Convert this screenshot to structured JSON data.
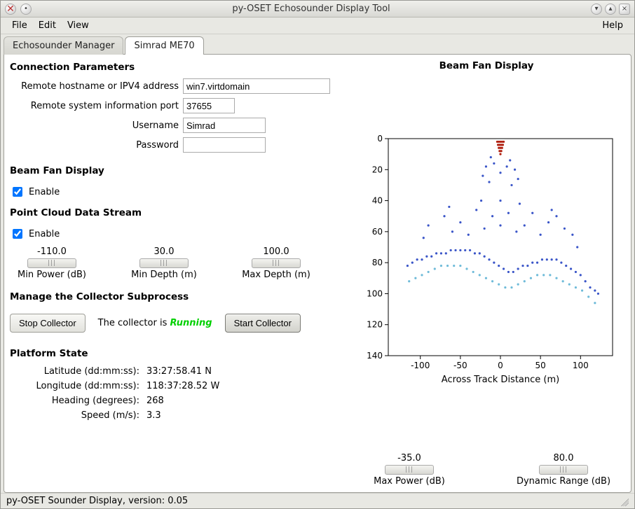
{
  "window": {
    "title": "py-OSET Echosounder Display Tool",
    "icons": {
      "app": "app-x-icon",
      "minimize": "minimize-icon",
      "maximize": "maximize-icon",
      "close": "close-icon",
      "unknown": "dot-icon"
    }
  },
  "menu": {
    "file": "File",
    "edit": "Edit",
    "view": "View",
    "help": "Help"
  },
  "tabs": [
    {
      "label": "Echosounder Manager",
      "active": false
    },
    {
      "label": "Simrad ME70",
      "active": true
    }
  ],
  "connection": {
    "heading": "Connection Parameters",
    "hostname_label": "Remote hostname or IPV4 address",
    "port_label": "Remote system information port",
    "username_label": "Username",
    "password_label": "Password",
    "hostname": "win7.virtdomain",
    "port": "37655",
    "username": "Simrad",
    "password": ""
  },
  "beamfan_section": {
    "heading": "Beam Fan Display",
    "enable_label": "Enable",
    "enable_checked": true
  },
  "pointcloud": {
    "heading": "Point Cloud Data Stream",
    "enable_label": "Enable",
    "enable_checked": true,
    "sliders": [
      {
        "value": "-110.0",
        "label": "Min Power (dB)"
      },
      {
        "value": "30.0",
        "label": "Min Depth (m)"
      },
      {
        "value": "100.0",
        "label": "Max Depth (m)"
      }
    ]
  },
  "collector": {
    "heading": "Manage the Collector Subprocess",
    "stop_label": "Stop Collector",
    "start_label": "Start Collector",
    "status_prefix": "The collector is ",
    "status_value": "Running"
  },
  "platform": {
    "heading": "Platform State",
    "rows": [
      {
        "label": "Latitude (dd:mm:ss):",
        "value": "33:27:58.41 N"
      },
      {
        "label": "Longitude (dd:mm:ss):",
        "value": "118:37:28.52 W"
      },
      {
        "label": "Heading (degrees):",
        "value": "268"
      },
      {
        "label": "Speed (m/s):",
        "value": "3.3"
      }
    ]
  },
  "beamfan_panel": {
    "title": "Beam Fan Display",
    "bottom_sliders": [
      {
        "value": "-35.0",
        "label": "Max Power (dB)"
      },
      {
        "value": "80.0",
        "label": "Dynamic Range (dB)"
      }
    ]
  },
  "chart_data": {
    "type": "scatter",
    "xlabel": "Across Track Distance (m)",
    "ylabel": "",
    "xlim": [
      -140,
      140
    ],
    "ylim": [
      140,
      0
    ],
    "xticks": [
      -100,
      -50,
      0,
      50,
      100
    ],
    "yticks": [
      0,
      20,
      40,
      60,
      80,
      100,
      120,
      140
    ],
    "series": [
      {
        "name": "dense-top",
        "color": "#b02010",
        "points": [
          [
            -4,
            2
          ],
          [
            -2,
            2
          ],
          [
            0,
            2
          ],
          [
            2,
            2
          ],
          [
            4,
            2
          ],
          [
            -3,
            4
          ],
          [
            -1,
            4
          ],
          [
            1,
            4
          ],
          [
            3,
            4
          ],
          [
            -2,
            6
          ],
          [
            0,
            6
          ],
          [
            2,
            6
          ],
          [
            -1,
            8
          ],
          [
            1,
            8
          ],
          [
            0,
            10
          ]
        ]
      },
      {
        "name": "sparse-top",
        "color": "#3a55c8",
        "points": [
          [
            -12,
            12
          ],
          [
            12,
            14
          ],
          [
            -18,
            18
          ],
          [
            18,
            20
          ],
          [
            -22,
            24
          ],
          [
            22,
            26
          ],
          [
            -8,
            16
          ],
          [
            8,
            18
          ],
          [
            0,
            22
          ],
          [
            -14,
            28
          ],
          [
            14,
            30
          ]
        ]
      },
      {
        "name": "band",
        "color": "#3a55c8",
        "points": [
          [
            -116,
            82
          ],
          [
            -110,
            80
          ],
          [
            -104,
            78
          ],
          [
            -98,
            78
          ],
          [
            -92,
            76
          ],
          [
            -86,
            76
          ],
          [
            -80,
            74
          ],
          [
            -74,
            74
          ],
          [
            -68,
            74
          ],
          [
            -62,
            72
          ],
          [
            -56,
            72
          ],
          [
            -50,
            72
          ],
          [
            -44,
            72
          ],
          [
            -38,
            72
          ],
          [
            -32,
            74
          ],
          [
            -26,
            74
          ],
          [
            -20,
            76
          ],
          [
            -14,
            78
          ],
          [
            -8,
            80
          ],
          [
            -2,
            82
          ],
          [
            4,
            84
          ],
          [
            10,
            86
          ],
          [
            16,
            86
          ],
          [
            22,
            84
          ],
          [
            28,
            82
          ],
          [
            34,
            82
          ],
          [
            40,
            80
          ],
          [
            46,
            80
          ],
          [
            52,
            78
          ],
          [
            58,
            78
          ],
          [
            64,
            78
          ],
          [
            70,
            78
          ],
          [
            76,
            80
          ],
          [
            82,
            82
          ],
          [
            88,
            84
          ],
          [
            94,
            86
          ],
          [
            100,
            88
          ],
          [
            106,
            92
          ],
          [
            112,
            96
          ],
          [
            118,
            98
          ],
          [
            122,
            100
          ]
        ]
      },
      {
        "name": "band-lower",
        "color": "#6fbbd9",
        "points": [
          [
            -114,
            92
          ],
          [
            -106,
            90
          ],
          [
            -98,
            88
          ],
          [
            -90,
            86
          ],
          [
            -82,
            84
          ],
          [
            -74,
            82
          ],
          [
            -66,
            82
          ],
          [
            -58,
            82
          ],
          [
            -50,
            82
          ],
          [
            -42,
            84
          ],
          [
            -34,
            86
          ],
          [
            -26,
            88
          ],
          [
            -18,
            90
          ],
          [
            -10,
            92
          ],
          [
            -2,
            94
          ],
          [
            6,
            96
          ],
          [
            14,
            96
          ],
          [
            22,
            94
          ],
          [
            30,
            92
          ],
          [
            38,
            90
          ],
          [
            46,
            88
          ],
          [
            54,
            88
          ],
          [
            62,
            88
          ],
          [
            70,
            90
          ],
          [
            78,
            92
          ],
          [
            86,
            94
          ],
          [
            94,
            96
          ],
          [
            102,
            98
          ],
          [
            110,
            102
          ],
          [
            118,
            106
          ]
        ]
      },
      {
        "name": "noise",
        "color": "#3a55c8",
        "points": [
          [
            -90,
            56
          ],
          [
            -70,
            50
          ],
          [
            -60,
            60
          ],
          [
            -50,
            54
          ],
          [
            -40,
            62
          ],
          [
            -30,
            46
          ],
          [
            -20,
            58
          ],
          [
            -10,
            50
          ],
          [
            0,
            56
          ],
          [
            10,
            48
          ],
          [
            20,
            60
          ],
          [
            30,
            56
          ],
          [
            40,
            48
          ],
          [
            50,
            62
          ],
          [
            60,
            54
          ],
          [
            70,
            50
          ],
          [
            80,
            58
          ],
          [
            90,
            62
          ],
          [
            96,
            70
          ],
          [
            -96,
            64
          ],
          [
            -64,
            44
          ],
          [
            64,
            46
          ],
          [
            -24,
            40
          ],
          [
            24,
            42
          ],
          [
            0,
            40
          ]
        ]
      }
    ]
  },
  "status": {
    "text": "py-OSET Sounder Display, version: 0.05"
  }
}
